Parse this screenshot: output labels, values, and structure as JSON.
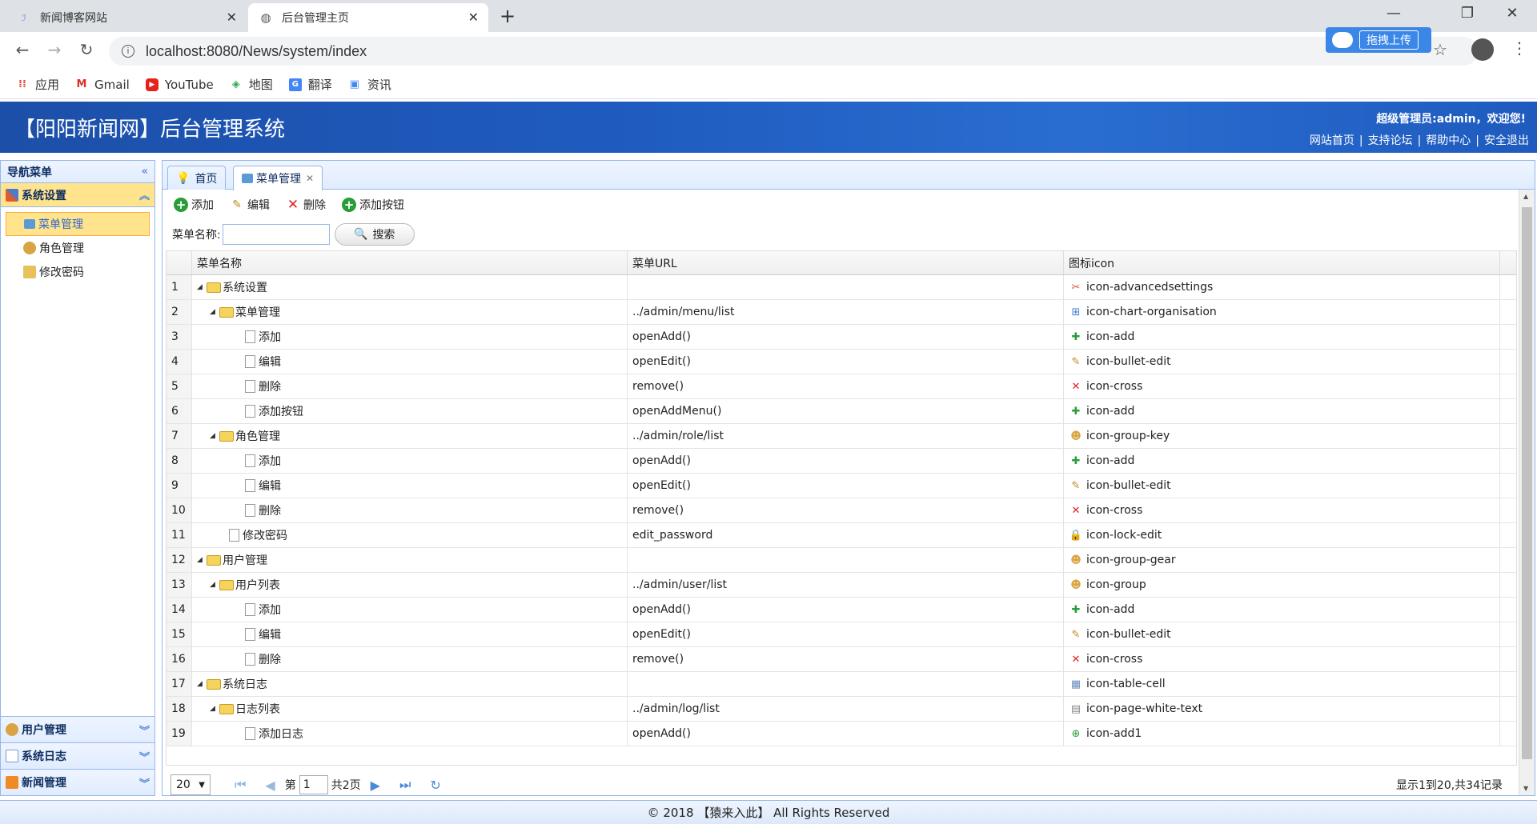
{
  "browser": {
    "tabs": [
      {
        "title": "新闻博客网站",
        "active": false
      },
      {
        "title": "后台管理主页",
        "active": true
      }
    ],
    "url": "localhost:8080/News/system/index",
    "upload_label": "拖拽上传",
    "bookmarks": [
      {
        "label": "应用",
        "icon": "apps-icon"
      },
      {
        "label": "Gmail",
        "icon": "gmail-icon"
      },
      {
        "label": "YouTube",
        "icon": "youtube-icon"
      },
      {
        "label": "地图",
        "icon": "maps-icon"
      },
      {
        "label": "翻译",
        "icon": "translate-icon"
      },
      {
        "label": "资讯",
        "icon": "news-icon"
      }
    ]
  },
  "header": {
    "title": "【阳阳新闻网】后台管理系统",
    "welcome": "超级管理员:admin，欢迎您!",
    "links": [
      "网站首页",
      "支持论坛",
      "帮助中心",
      "安全退出"
    ]
  },
  "nav": {
    "title": "导航菜单",
    "sections": [
      {
        "label": "系统设置",
        "expanded": true,
        "items": [
          "菜单管理",
          "角色管理",
          "修改密码"
        ],
        "selected_item": "菜单管理"
      },
      {
        "label": "用户管理",
        "expanded": false
      },
      {
        "label": "系统日志",
        "expanded": false
      },
      {
        "label": "新闻管理",
        "expanded": false
      }
    ]
  },
  "main": {
    "tabs": [
      {
        "label": "首页",
        "closable": false
      },
      {
        "label": "菜单管理",
        "closable": true
      }
    ],
    "toolbar": {
      "add": "添加",
      "edit": "编辑",
      "delete": "删除",
      "add_button": "添加按钮"
    },
    "search": {
      "label": "菜单名称:",
      "value": "",
      "button": "搜索"
    },
    "grid": {
      "columns": [
        "菜单名称",
        "菜单URL",
        "图标icon"
      ],
      "rows": [
        {
          "n": "1",
          "level": 0,
          "type": "folder",
          "name": "系统设置",
          "url": "",
          "icon": "icon-advancedsettings"
        },
        {
          "n": "2",
          "level": 1,
          "type": "folder",
          "name": "菜单管理",
          "url": "../admin/menu/list",
          "icon": "icon-chart-organisation"
        },
        {
          "n": "3",
          "level": 2,
          "type": "file",
          "name": "添加",
          "url": "openAdd()",
          "icon": "icon-add"
        },
        {
          "n": "4",
          "level": 2,
          "type": "file",
          "name": "编辑",
          "url": "openEdit()",
          "icon": "icon-bullet-edit"
        },
        {
          "n": "5",
          "level": 2,
          "type": "file",
          "name": "删除",
          "url": "remove()",
          "icon": "icon-cross"
        },
        {
          "n": "6",
          "level": 2,
          "type": "file",
          "name": "添加按钮",
          "url": "openAddMenu()",
          "icon": "icon-add"
        },
        {
          "n": "7",
          "level": 1,
          "type": "folder",
          "name": "角色管理",
          "url": "../admin/role/list",
          "icon": "icon-group-key"
        },
        {
          "n": "8",
          "level": 2,
          "type": "file",
          "name": "添加",
          "url": "openAdd()",
          "icon": "icon-add"
        },
        {
          "n": "9",
          "level": 2,
          "type": "file",
          "name": "编辑",
          "url": "openEdit()",
          "icon": "icon-bullet-edit"
        },
        {
          "n": "10",
          "level": 2,
          "type": "file",
          "name": "删除",
          "url": "remove()",
          "icon": "icon-cross"
        },
        {
          "n": "11",
          "level": 1,
          "type": "file",
          "name": "修改密码",
          "url": "edit_password",
          "icon": "icon-lock-edit"
        },
        {
          "n": "12",
          "level": 0,
          "type": "folder",
          "name": "用户管理",
          "url": "",
          "icon": "icon-group-gear"
        },
        {
          "n": "13",
          "level": 1,
          "type": "folder",
          "name": "用户列表",
          "url": "../admin/user/list",
          "icon": "icon-group"
        },
        {
          "n": "14",
          "level": 2,
          "type": "file",
          "name": "添加",
          "url": "openAdd()",
          "icon": "icon-add"
        },
        {
          "n": "15",
          "level": 2,
          "type": "file",
          "name": "编辑",
          "url": "openEdit()",
          "icon": "icon-bullet-edit"
        },
        {
          "n": "16",
          "level": 2,
          "type": "file",
          "name": "删除",
          "url": "remove()",
          "icon": "icon-cross"
        },
        {
          "n": "17",
          "level": 0,
          "type": "folder",
          "name": "系统日志",
          "url": "",
          "icon": "icon-table-cell"
        },
        {
          "n": "18",
          "level": 1,
          "type": "folder",
          "name": "日志列表",
          "url": "../admin/log/list",
          "icon": "icon-page-white-text"
        },
        {
          "n": "19",
          "level": 2,
          "type": "file",
          "name": "添加日志",
          "url": "openAdd()",
          "icon": "icon-add1"
        }
      ]
    },
    "pager": {
      "page_size": "20",
      "page_label_before": "第",
      "page_value": "1",
      "page_label_after": "共2页",
      "info": "显示1到20,共34记录"
    }
  },
  "footer": {
    "text": "© 2018 【猿来入此】 All Rights Reserved"
  }
}
